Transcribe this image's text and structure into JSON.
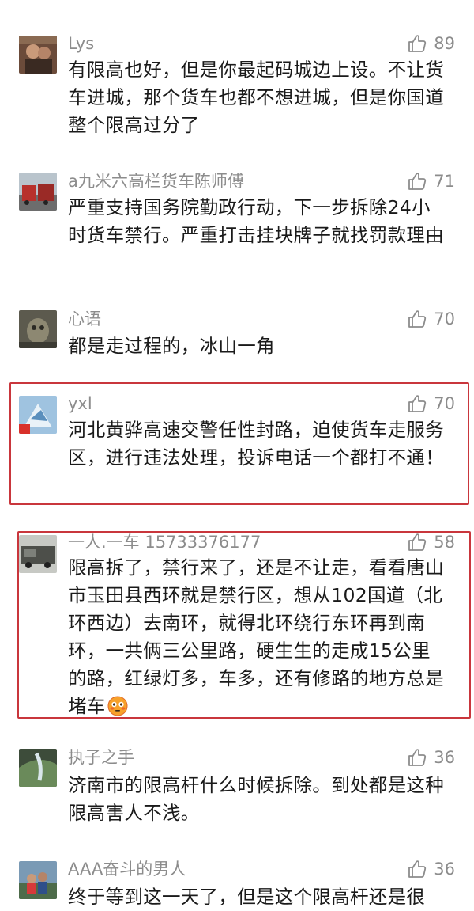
{
  "comments": [
    {
      "user": "Lys",
      "likes": "89",
      "text": "有限高也好，但是你最起码城边上设。不让货车进城，那个货车也都不想进城，但是你国道整个限高过分了"
    },
    {
      "user": "a九米六高栏货车陈师傅",
      "likes": "71",
      "text": "严重支持国务院勤政行动，下一步拆除24小时货车禁行。严重打击挂块牌子就找罚款理由"
    },
    {
      "user": "心语",
      "likes": "70",
      "text": "都是走过程的，冰山一角"
    },
    {
      "user": "yxl",
      "likes": "70",
      "text": "河北黄骅高速交警任性封路，迫使货车走服务区，进行违法处理，投诉电话一个都打不通！"
    },
    {
      "user": "一人.一车 15733376177",
      "likes": "58",
      "text": "限高拆了，禁行来了，还是不让走，看看唐山市玉田县西环就是禁行区，想从102国道（北环西边）去南环，就得北环绕行东环再到南环，一共俩三公里路，硬生生的走成15公里的路，红绿灯多，车多，还有修路的地方总是堵车"
    },
    {
      "user": "执子之手",
      "likes": "36",
      "text": "济南市的限高杆什么时候拆除。到处都是这种限高害人不浅。"
    },
    {
      "user": "AAA奋斗的男人",
      "likes": "36",
      "text": "终于等到这一天了，但是这个限高杆还是很"
    }
  ],
  "colors": {
    "highlight_border": "#c9363c",
    "name_gray": "#8c8c8c",
    "text_dark": "#1a1a1a"
  },
  "icons": {
    "like": "thumbs-up-icon",
    "emoji": "flushed-face-emoji-icon"
  }
}
